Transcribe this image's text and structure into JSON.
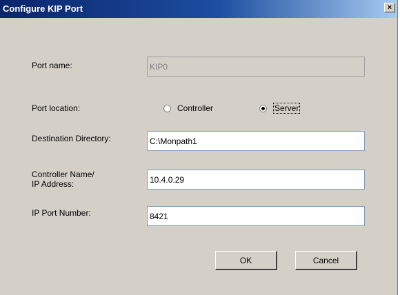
{
  "window": {
    "title": "Configure KIP Port",
    "close_glyph": "×"
  },
  "form": {
    "port_name": {
      "label": "Port name:",
      "value": "KIP0",
      "disabled": true
    },
    "port_location": {
      "label": "Port location:",
      "options": [
        {
          "label": "Controller",
          "selected": false
        },
        {
          "label": "Server",
          "selected": true
        }
      ]
    },
    "destination_directory": {
      "label": "Destination Directory:",
      "value": "C:\\Monpath1"
    },
    "controller_name": {
      "label_line1": "Controller Name/",
      "label_line2": "IP Address:",
      "value": "10.4.0.29"
    },
    "ip_port_number": {
      "label": "IP Port Number:",
      "value": "8421"
    }
  },
  "buttons": {
    "ok": "OK",
    "cancel": "Cancel"
  },
  "colors": {
    "dialog_bg": "#d4d0c8",
    "title_start": "#0a246a",
    "title_end": "#a6caf0"
  }
}
